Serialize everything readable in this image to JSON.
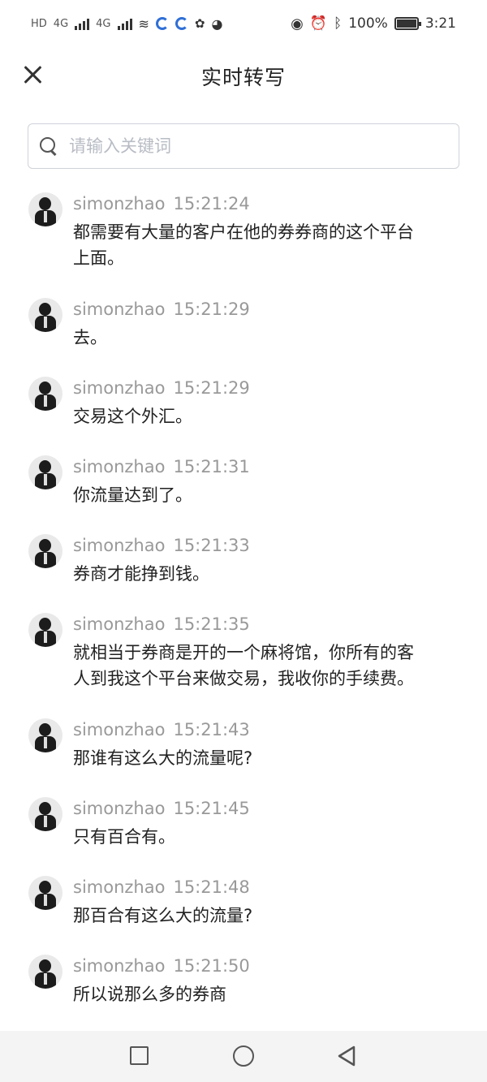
{
  "status_bar": {
    "network1": "4G",
    "network2": "4G",
    "battery_percent": "100%",
    "time": "3:21",
    "battery_level": 1.0,
    "icons": [
      "hd-icon",
      "signal-icon",
      "wifi-icon",
      "app-icon",
      "eye-icon",
      "alarm-icon",
      "bluetooth-icon",
      "battery-icon"
    ]
  },
  "header": {
    "title": "实时转写",
    "close_icon": "close-icon"
  },
  "search": {
    "placeholder": "请输入关键词",
    "value": ""
  },
  "messages": [
    {
      "user": "simonzhao",
      "time": "15:21:24",
      "text_lines": [
        "都需要有大量的客户在他的券券商的这个平台",
        "上面。"
      ]
    },
    {
      "user": "simonzhao",
      "time": "15:21:29",
      "text_lines": [
        "去。"
      ]
    },
    {
      "user": "simonzhao",
      "time": "15:21:29",
      "text_lines": [
        "交易这个外汇。"
      ]
    },
    {
      "user": "simonzhao",
      "time": "15:21:31",
      "text_lines": [
        "你流量达到了。"
      ]
    },
    {
      "user": "simonzhao",
      "time": "15:21:33",
      "text_lines": [
        "券商才能挣到钱。"
      ]
    },
    {
      "user": "simonzhao",
      "time": "15:21:35",
      "text_lines": [
        "就相当于券商是开的一个麻将馆，你所有的客",
        "人到我这个平台来做交易，我收你的手续费。"
      ]
    },
    {
      "user": "simonzhao",
      "time": "15:21:43",
      "text_lines": [
        "那谁有这么大的流量呢?"
      ]
    },
    {
      "user": "simonzhao",
      "time": "15:21:45",
      "text_lines": [
        "只有百合有。"
      ]
    },
    {
      "user": "simonzhao",
      "time": "15:21:48",
      "text_lines": [
        "那百合有这么大的流量?"
      ]
    },
    {
      "user": "simonzhao",
      "time": "15:21:50",
      "text_lines": [
        "所以说那么多的券商"
      ]
    }
  ],
  "nav": {
    "icons": [
      "recent-apps-icon",
      "home-icon",
      "back-icon"
    ]
  }
}
